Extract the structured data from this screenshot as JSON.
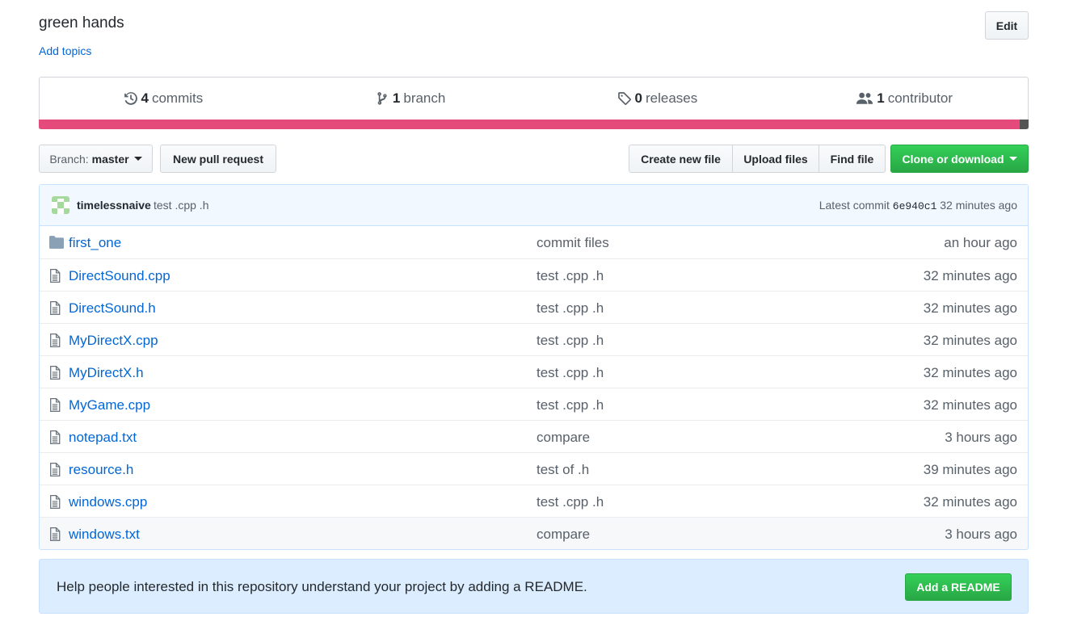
{
  "repo": {
    "description": "green hands",
    "add_topics": "Add topics",
    "edit_label": "Edit"
  },
  "summary": {
    "commits": {
      "count": "4",
      "label": "commits",
      "icon": "history-icon"
    },
    "branches": {
      "count": "1",
      "label": "branch",
      "icon": "git-branch-icon"
    },
    "releases": {
      "count": "0",
      "label": "releases",
      "icon": "tag-icon"
    },
    "contributors": {
      "count": "1",
      "label": "contributor",
      "icon": "people-icon"
    },
    "language_colors": [
      "#e44b7b",
      "#555555"
    ]
  },
  "toolbar": {
    "branch_prefix": "Branch:",
    "branch_name": "master",
    "new_pull_request": "New pull request",
    "create_new_file": "Create new file",
    "upload_files": "Upload files",
    "find_file": "Find file",
    "clone_or_download": "Clone or download"
  },
  "latest_commit": {
    "author": "timelessnaive",
    "message": "test .cpp .h",
    "label": "Latest commit",
    "sha": "6e940c1",
    "age": "32 minutes ago"
  },
  "files": [
    {
      "name": "first_one",
      "type": "directory",
      "icon": "folder-icon",
      "commit": "commit files",
      "age": "an hour ago"
    },
    {
      "name": "DirectSound.cpp",
      "type": "file",
      "icon": "file-icon",
      "commit": "test .cpp .h",
      "age": "32 minutes ago"
    },
    {
      "name": "DirectSound.h",
      "type": "file",
      "icon": "file-icon",
      "commit": "test .cpp .h",
      "age": "32 minutes ago"
    },
    {
      "name": "MyDirectX.cpp",
      "type": "file",
      "icon": "file-icon",
      "commit": "test .cpp .h",
      "age": "32 minutes ago"
    },
    {
      "name": "MyDirectX.h",
      "type": "file",
      "icon": "file-icon",
      "commit": "test .cpp .h",
      "age": "32 minutes ago"
    },
    {
      "name": "MyGame.cpp",
      "type": "file",
      "icon": "file-icon",
      "commit": "test .cpp .h",
      "age": "32 minutes ago"
    },
    {
      "name": "notepad.txt",
      "type": "file",
      "icon": "file-icon",
      "commit": "compare",
      "age": "3 hours ago"
    },
    {
      "name": "resource.h",
      "type": "file",
      "icon": "file-icon",
      "commit": "test of .h",
      "age": "39 minutes ago"
    },
    {
      "name": "windows.cpp",
      "type": "file",
      "icon": "file-icon",
      "commit": "test .cpp .h",
      "age": "32 minutes ago"
    },
    {
      "name": "windows.txt",
      "type": "file",
      "icon": "file-icon",
      "commit": "compare",
      "age": "3 hours ago"
    }
  ],
  "readme": {
    "message": "Help people interested in this repository understand your project by adding a README.",
    "button": "Add a README"
  },
  "colors": {
    "link": "#0366d6",
    "primary_button": "#28a745",
    "readme_banner": "#dbedff"
  }
}
